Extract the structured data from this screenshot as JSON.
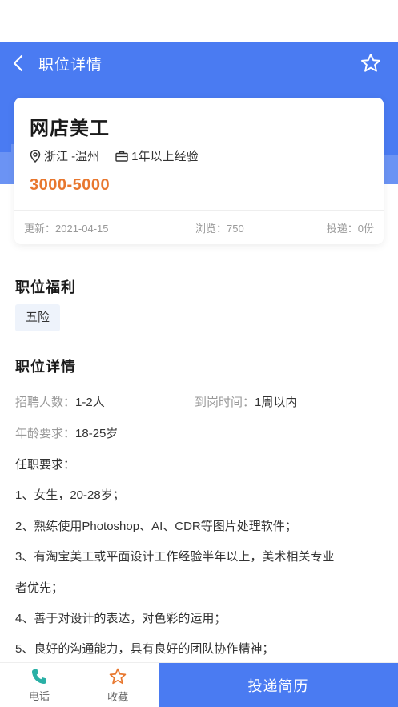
{
  "nav": {
    "title": "职位详情"
  },
  "job": {
    "title": "网店美工",
    "location": "浙江 -温州",
    "experience": "1年以上经验",
    "salary": "3000-5000",
    "update": "更新：2021-04-15",
    "views": "浏览：750",
    "applies": "投递：0份"
  },
  "benefits": {
    "title": "职位福利",
    "tags": [
      "五险"
    ]
  },
  "details": {
    "title": "职位详情",
    "headcount_label": "招聘人数：",
    "headcount_value": "1-2人",
    "arrival_label": "到岗时间：",
    "arrival_value": "1周以内",
    "age_label": "年龄要求：",
    "age_value": "18-25岁",
    "requirements": [
      "任职要求：",
      "1、女生，20-28岁；",
      "2、熟练使用Photoshop、AI、CDR等图片处理软件；",
      "3、有淘宝美工或平面设计工作经验半年以上，美术相关专业",
      "者优先；",
      "4、善于对设计的表达，对色彩的运用；",
      "5、良好的沟通能力，具有良好的团队协作精神；"
    ]
  },
  "bottom": {
    "phone_label": "电话",
    "favorite_label": "收藏",
    "apply_label": "投递简历"
  },
  "colors": {
    "primary": "#4a7bf2",
    "salary": "#e8772e",
    "phone_icon": "#2ab0a6",
    "fav_icon": "#e8772e"
  }
}
